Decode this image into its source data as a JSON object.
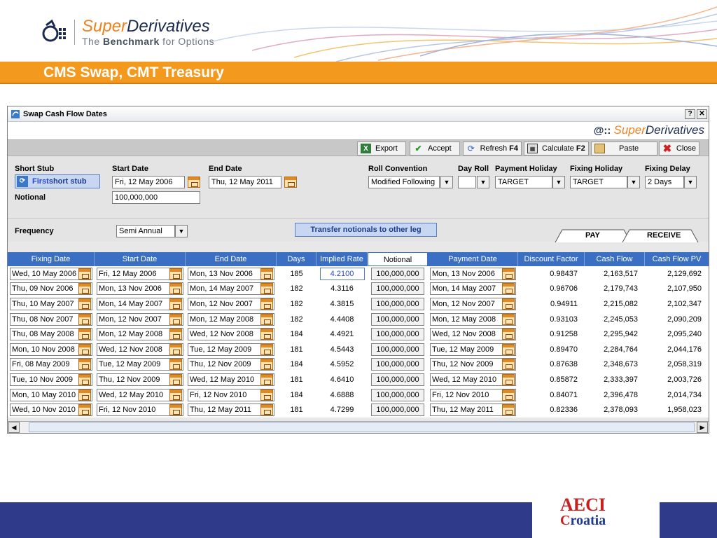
{
  "brand": {
    "name_part1": "Super",
    "name_part2": "Derivatives",
    "tagline_pre": "The ",
    "tagline_bold": "Benchmark",
    "tagline_post": " for Options"
  },
  "slide_title": "CMS Swap, CMT Treasury",
  "window": {
    "title": "Swap Cash Flow Dates",
    "help_label": "?",
    "close_label": "✕",
    "brand_part1": "Super",
    "brand_part2": "Derivatives"
  },
  "toolbar": {
    "export": "Export",
    "accept": "Accept",
    "refresh": "Refresh",
    "refresh_key": "F4",
    "calculate": "Calculate",
    "calculate_key": "F2",
    "paste": "Paste",
    "close": "Close"
  },
  "params": {
    "short_stub_label": "Short Stub",
    "short_stub_btn_a": "First",
    "short_stub_btn_b": " short stub",
    "start_date_label": "Start Date",
    "start_date": "Fri, 12 May 2006",
    "end_date_label": "End Date",
    "end_date": "Thu, 12 May 2011",
    "notional_label": "Notional",
    "notional": "100,000,000",
    "roll_convention_label": "Roll Convention",
    "roll_convention": "Modified Following",
    "day_roll_label": "Day Roll",
    "day_roll": "",
    "payment_holiday_label": "Payment Holiday",
    "payment_holiday": "TARGET",
    "fixing_holiday_label": "Fixing Holiday",
    "fixing_holiday": "TARGET",
    "fixing_delay_label": "Fixing Delay",
    "fixing_delay": "2 Days"
  },
  "frequency": {
    "label": "Frequency",
    "value": "Semi Annual",
    "transfer_button": "Transfer notionals to other leg",
    "tab_pay": "PAY",
    "tab_receive": "RECEIVE"
  },
  "table": {
    "headers": [
      "Fixing Date",
      "Start Date",
      "End Date",
      "Days",
      "Implied Rate",
      "Notional",
      "Payment Date",
      "Discount Factor",
      "Cash Flow",
      "Cash Flow PV"
    ],
    "rows": [
      [
        "Wed, 10 May 2006",
        "Fri, 12 May 2006",
        "Mon, 13 Nov 2006",
        "185",
        "4.2100",
        "100,000,000",
        "Mon, 13 Nov 2006",
        "0.98437",
        "2,163,517",
        "2,129,692"
      ],
      [
        "Thu, 09 Nov 2006",
        "Mon, 13 Nov 2006",
        "Mon, 14 May 2007",
        "182",
        "4.3116",
        "100,000,000",
        "Mon, 14 May 2007",
        "0.96706",
        "2,179,743",
        "2,107,950"
      ],
      [
        "Thu, 10 May 2007",
        "Mon, 14 May 2007",
        "Mon, 12 Nov 2007",
        "182",
        "4.3815",
        "100,000,000",
        "Mon, 12 Nov 2007",
        "0.94911",
        "2,215,082",
        "2,102,347"
      ],
      [
        "Thu, 08 Nov 2007",
        "Mon, 12 Nov 2007",
        "Mon, 12 May 2008",
        "182",
        "4.4408",
        "100,000,000",
        "Mon, 12 May 2008",
        "0.93103",
        "2,245,053",
        "2,090,209"
      ],
      [
        "Thu, 08 May 2008",
        "Mon, 12 May 2008",
        "Wed, 12 Nov 2008",
        "184",
        "4.4921",
        "100,000,000",
        "Wed, 12 Nov 2008",
        "0.91258",
        "2,295,942",
        "2,095,240"
      ],
      [
        "Mon, 10 Nov 2008",
        "Wed, 12 Nov 2008",
        "Tue, 12 May 2009",
        "181",
        "4.5443",
        "100,000,000",
        "Tue, 12 May 2009",
        "0.89470",
        "2,284,764",
        "2,044,176"
      ],
      [
        "Fri, 08 May 2009",
        "Tue, 12 May 2009",
        "Thu, 12 Nov 2009",
        "184",
        "4.5952",
        "100,000,000",
        "Thu, 12 Nov 2009",
        "0.87638",
        "2,348,673",
        "2,058,319"
      ],
      [
        "Tue, 10 Nov 2009",
        "Thu, 12 Nov 2009",
        "Wed, 12 May 2010",
        "181",
        "4.6410",
        "100,000,000",
        "Wed, 12 May 2010",
        "0.85872",
        "2,333,397",
        "2,003,726"
      ],
      [
        "Mon, 10 May 2010",
        "Wed, 12 May 2010",
        "Fri, 12 Nov 2010",
        "184",
        "4.6888",
        "100,000,000",
        "Fri, 12 Nov 2010",
        "0.84071",
        "2,396,478",
        "2,014,734"
      ],
      [
        "Wed, 10 Nov 2010",
        "Fri, 12 Nov 2010",
        "Thu, 12 May 2011",
        "181",
        "4.7299",
        "100,000,000",
        "Thu, 12 May 2011",
        "0.82336",
        "2,378,093",
        "1,958,023"
      ]
    ]
  },
  "footer_logo": {
    "line1": "AECI",
    "line2_c": "C",
    "line2_rest": "roatia"
  },
  "colors": {
    "accent_orange": "#f39a1e",
    "grid_header_blue": "#3a6fc4",
    "footer_navy": "#2f3a8a"
  }
}
